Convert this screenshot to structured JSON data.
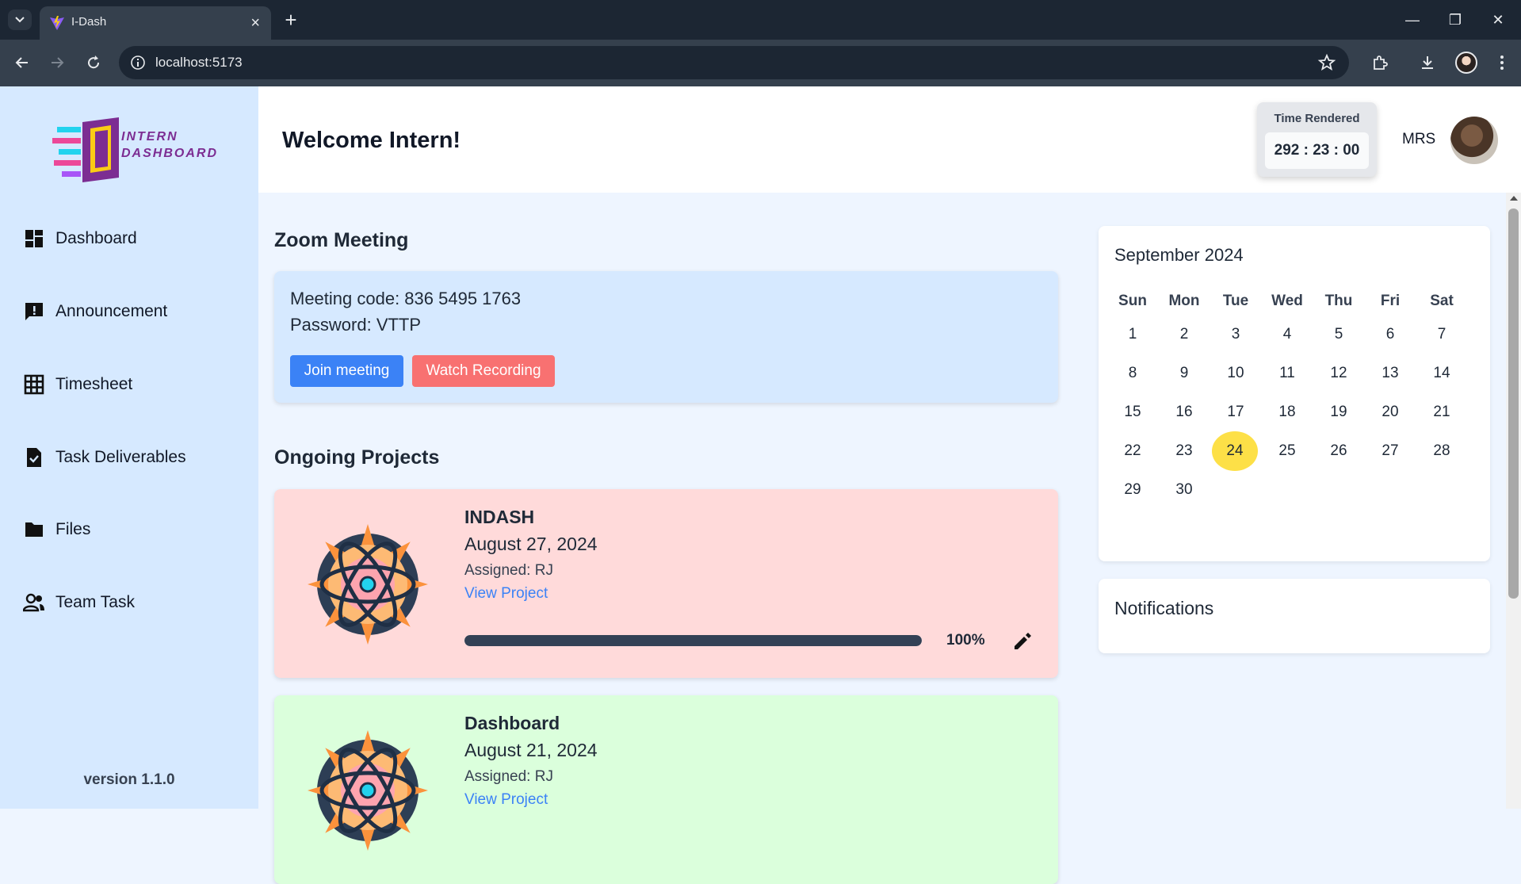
{
  "browser": {
    "tab_title": "I-Dash",
    "url": "localhost:5173"
  },
  "sidebar": {
    "logo_text_line1": "INTERN",
    "logo_text_line2": "DASHBOARD",
    "items": [
      {
        "label": "Dashboard",
        "icon": "dashboard-icon"
      },
      {
        "label": "Announcement",
        "icon": "announcement-icon"
      },
      {
        "label": "Timesheet",
        "icon": "grid-icon"
      },
      {
        "label": "Task Deliverables",
        "icon": "task-file-icon"
      },
      {
        "label": "Files",
        "icon": "folder-icon"
      },
      {
        "label": "Team Task",
        "icon": "team-icon"
      }
    ],
    "version": "version 1.1.0"
  },
  "header": {
    "welcome": "Welcome Intern!",
    "time_label": "Time Rendered",
    "time_value": "292 : 23 : 00",
    "user_name": "MRS"
  },
  "zoom": {
    "title": "Zoom Meeting",
    "meeting_code": "Meeting code: 836 5495 1763",
    "password": "Password: VTTP",
    "join_label": "Join meeting",
    "recording_label": "Watch Recording"
  },
  "projects": {
    "title": "Ongoing Projects",
    "items": [
      {
        "name": "INDASH",
        "date": "August 27, 2024",
        "assigned": "Assigned: RJ",
        "link": "View Project",
        "progress_pct": "100%",
        "progress": 1.0,
        "bg": "#ffdada"
      },
      {
        "name": "Dashboard",
        "date": "August 21, 2024",
        "assigned": "Assigned: RJ",
        "link": "View Project",
        "bg": "#dbffdc"
      }
    ]
  },
  "calendar": {
    "title": "September 2024",
    "weekdays": [
      "Sun",
      "Mon",
      "Tue",
      "Wed",
      "Thu",
      "Fri",
      "Sat"
    ],
    "weeks": [
      [
        "1",
        "2",
        "3",
        "4",
        "5",
        "6",
        "7"
      ],
      [
        "8",
        "9",
        "10",
        "11",
        "12",
        "13",
        "14"
      ],
      [
        "15",
        "16",
        "17",
        "18",
        "19",
        "20",
        "21"
      ],
      [
        "22",
        "23",
        "24",
        "25",
        "26",
        "27",
        "28"
      ],
      [
        "29",
        "30",
        "",
        "",
        "",
        "",
        ""
      ]
    ],
    "today": "24",
    "today_color": "#fde047"
  },
  "notifications": {
    "title": "Notifications"
  },
  "colors": {
    "accent_blue": "#3b82f6",
    "accent_red": "#f87171",
    "sidebar_bg": "#d6e9ff"
  }
}
